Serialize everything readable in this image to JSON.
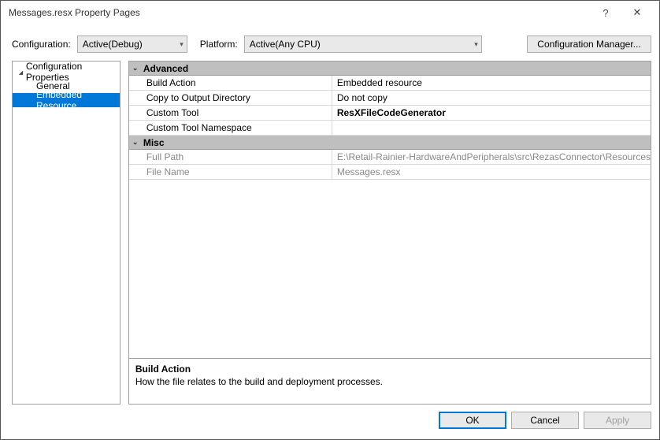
{
  "title": "Messages.resx Property Pages",
  "titlebar": {
    "help": "?",
    "close": "✕"
  },
  "config": {
    "configurationLabel": "Configuration:",
    "configurationValue": "Active(Debug)",
    "platformLabel": "Platform:",
    "platformValue": "Active(Any CPU)",
    "managerButton": "Configuration Manager..."
  },
  "tree": {
    "root": "Configuration Properties",
    "general": "General",
    "embeddedResource": "Embedded Resource"
  },
  "categories": {
    "advanced": "Advanced",
    "misc": "Misc"
  },
  "props": {
    "buildAction": {
      "name": "Build Action",
      "value": "Embedded resource"
    },
    "copyToOutput": {
      "name": "Copy to Output Directory",
      "value": "Do not copy"
    },
    "customTool": {
      "name": "Custom Tool",
      "value": "ResXFileCodeGenerator"
    },
    "customToolNs": {
      "name": "Custom Tool Namespace",
      "value": ""
    },
    "fullPath": {
      "name": "Full Path",
      "value": "E:\\Retail-Rainier-HardwareAndPeripherals\\src\\RezasConnector\\Resources"
    },
    "fileName": {
      "name": "File Name",
      "value": "Messages.resx"
    }
  },
  "desc": {
    "title": "Build Action",
    "text": "How the file relates to the build and deployment processes."
  },
  "buttons": {
    "ok": "OK",
    "cancel": "Cancel",
    "apply": "Apply"
  }
}
